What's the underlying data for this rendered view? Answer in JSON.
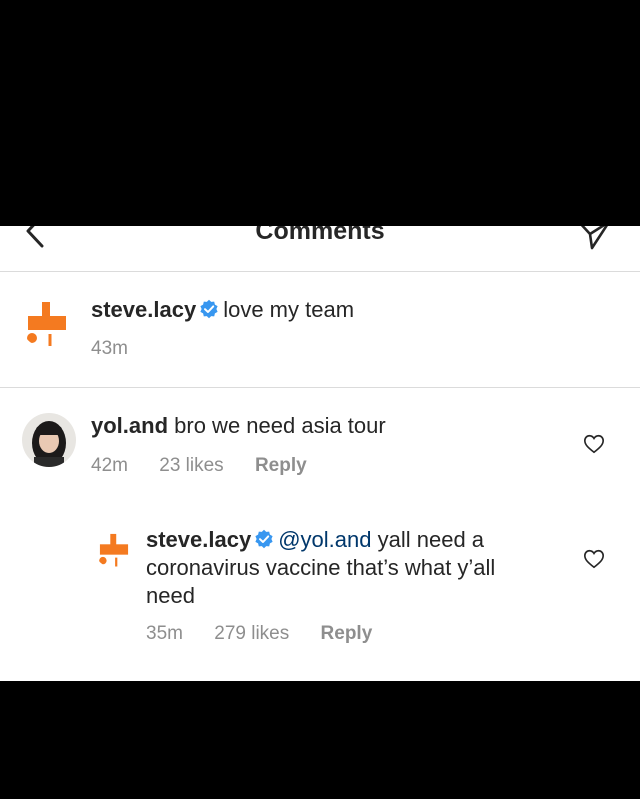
{
  "header": {
    "title": "Comments"
  },
  "caption": {
    "username": "steve.lacy",
    "text": "love my team",
    "time": "43m"
  },
  "comments": [
    {
      "username": "yol.and",
      "text": "bro we need asia tour",
      "time": "42m",
      "likes": "23 likes",
      "reply_label": "Reply",
      "replies": [
        {
          "username": "steve.lacy",
          "mention": "@yol.and",
          "text": "yall need a coronavirus vaccine that’s what y’all need",
          "time": "35m",
          "likes": "279 likes",
          "reply_label": "Reply"
        }
      ]
    }
  ],
  "colors": {
    "verified": "#3897f0",
    "avatar_orange": "#f47a20",
    "text": "#262626",
    "meta": "#8e8e8e",
    "mention": "#00376b"
  },
  "icons": {
    "back": "chevron-left-icon",
    "share": "paper-plane-icon",
    "like": "heart-icon",
    "verified": "verified-badge-icon"
  }
}
